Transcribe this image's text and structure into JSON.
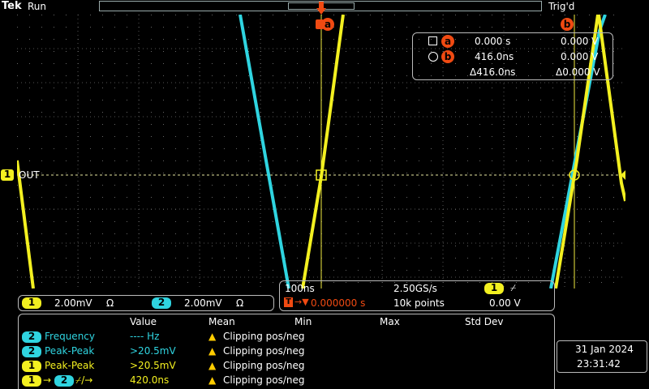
{
  "status": {
    "brand": "Tek",
    "run": "Run",
    "trigger": "Trig'd"
  },
  "colors": {
    "ch1": "#f3f020",
    "ch2": "#2fd4e0",
    "marker": "#f04a12",
    "grid": "#8a8a8a"
  },
  "markers": {
    "a": "a",
    "b": "b"
  },
  "ground_label": "OUT",
  "cursor": {
    "a_time": "0.000 s",
    "a_volt": "0.000 V",
    "b_time": "416.0ns",
    "b_volt": "0.000 V",
    "delta_time": "Δ416.0ns",
    "delta_volt": "Δ0.000 V"
  },
  "channels": [
    {
      "num": "1",
      "scale": "2.00mV",
      "term": "Ω"
    },
    {
      "num": "2",
      "scale": "2.00mV",
      "term": "Ω"
    }
  ],
  "horizontal": {
    "timebase": "100ns",
    "sample_rate": "2.50GS/s",
    "trigger_ch": "1",
    "trigger_slope": "⌿",
    "trigger_pos": "0.000000 s",
    "record": "10k points",
    "trigger_level": "0.00 V",
    "trigger_icon": "T"
  },
  "measurements": {
    "headers": [
      "Value",
      "Mean",
      "Min",
      "Max",
      "Std Dev"
    ],
    "rows": [
      {
        "ch": "2",
        "name": "Frequency",
        "value": "---- Hz",
        "status": "Clipping pos/neg"
      },
      {
        "ch": "2",
        "name": "Peak-Peak",
        "value": ">20.5mV",
        "status": "Clipping pos/neg"
      },
      {
        "ch": "1",
        "name": "Peak-Peak",
        "value": ">20.5mV",
        "status": "Clipping pos/neg"
      },
      {
        "ch_from": "1",
        "ch_to": "2",
        "name": "⌿/→",
        "value": "420.0ns",
        "status": "Clipping pos/neg"
      }
    ]
  },
  "datetime": {
    "date": "31 Jan  2024",
    "time": "23:31:42"
  }
}
